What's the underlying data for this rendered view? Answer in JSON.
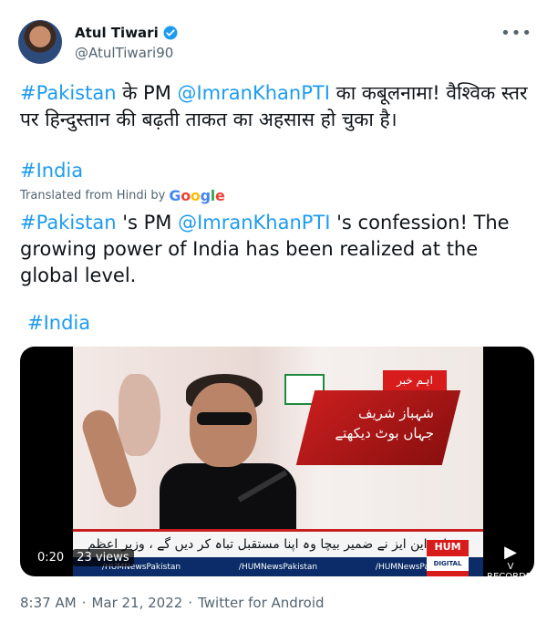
{
  "author": {
    "name": "Atul Tiwari",
    "handle": "@AtulTiwari90",
    "verified_icon": "verified-badge-icon"
  },
  "more_icon": "more-options-icon",
  "tweet": {
    "hindi_hashtag": "#Pakistan",
    "hindi_part1": " के PM ",
    "hindi_mention": "@ImranKhanPTI",
    "hindi_part2": " का कबूलनामा! वैश्विक स्तर पर हिन्दुस्तान की बढ़ती ताकत का अहसास हो चुका है।",
    "hashtag_india": "#India",
    "translated_label": "Translated from Hindi by",
    "google_label": "Google",
    "en_hashtag": "#Pakistan",
    "en_part1": " 's PM ",
    "en_mention": "@ImranKhanPTI",
    "en_part2": " 's confession! The growing power of India has been realized at the global level.",
    "en_hashtag_india": "#India"
  },
  "video": {
    "time": "0:20",
    "views": "23 views",
    "news_red_text": "شہباز شریف جہاں بوٹ دیکھتے",
    "news_tag": "اہم خبر",
    "ticker_text": "جن ایم این ایز نے ضمیر بیچا وہ اپنا مستقبل تباہ کر دیں گے ، وزیر اعظم",
    "bottom_items": [
      "/HUMNewsPakistan",
      "/HUMNewsPakistan",
      "/HUMNewsPakistan"
    ],
    "hum_logo": "HUM",
    "hum_sub": "DIGITAL",
    "recorder_label": "V RECORDER"
  },
  "meta": {
    "time": "8:37 AM",
    "separator": "·",
    "date": "Mar 21, 2022",
    "separator2": "·",
    "source": "Twitter for Android"
  },
  "colors": {
    "link": "#1d9bf0",
    "text": "#0f1419",
    "muted": "#536471"
  }
}
